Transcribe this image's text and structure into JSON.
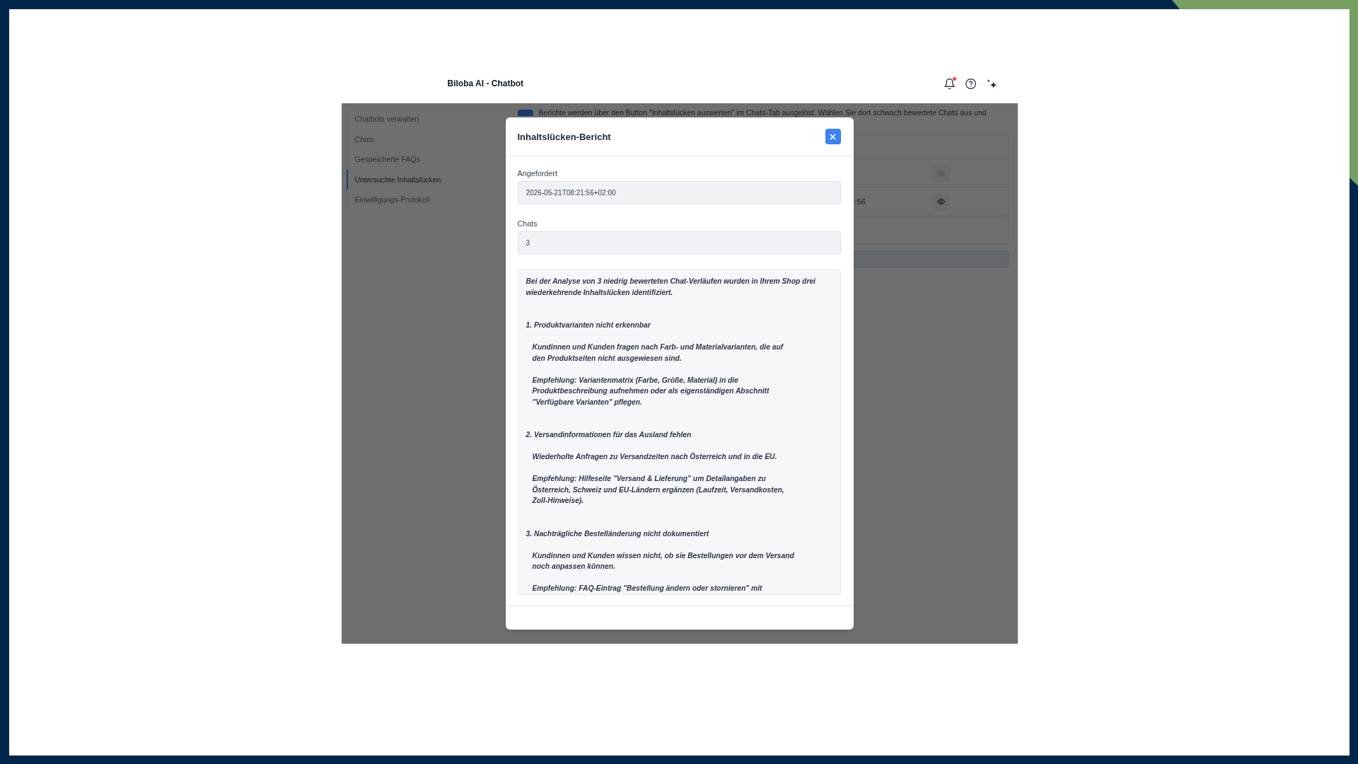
{
  "header": {
    "title": "Biloba AI - Chatbot",
    "unread_notifications": true
  },
  "sidebar": {
    "items": [
      {
        "label": "Chatbots verwalten",
        "selected": false
      },
      {
        "label": "Chats",
        "selected": false
      },
      {
        "label": "Gespeicherte FAQs",
        "selected": false
      },
      {
        "label": "Untersuchte Inhaltslücken",
        "selected": true
      },
      {
        "label": "Einwilligungs-Protokoll",
        "selected": false
      }
    ]
  },
  "content": {
    "notice": "Berichte werden über den Button \"Inhaltslücken auswerten\" im Chats-Tab ausgelöst. Wählen Sie dort schwach bewertete Chats aus und",
    "table": {
      "rows": [
        {
          "view_disabled": true
        },
        {
          "column_2": ":56",
          "view_disabled": false
        }
      ]
    }
  },
  "dialog": {
    "title": "Inhaltslücken-Bericht",
    "fields": [
      {
        "label": "Angefordert",
        "value": "2026-05-21T08:21:56+02:00"
      },
      {
        "label": "Chats",
        "value": "3"
      }
    ],
    "report": {
      "intro": "Bei der Analyse von 3 niedrig bewerteten Chat-Verläufen wurden in Ihrem Shop drei\nwiederkehrende Inhaltslücken identifiziert.",
      "sections": [
        {
          "heading": "1. Produktvarianten nicht erkennbar",
          "paragraphs": [
            "Kundinnen und Kunden fragen nach Farb- und Materialvarianten, die auf\nden Produktseiten nicht ausgewiesen sind.",
            "Empfehlung: Variantenmatrix (Farbe, Größe, Material) in die\nProduktbeschreibung aufnehmen oder als eigenständigen Abschnitt\n\"Verfügbare Varianten\" pflegen."
          ]
        },
        {
          "heading": "2. Versandinformationen für das Ausland fehlen",
          "paragraphs": [
            "Wiederholte Anfragen zu Versandzeiten nach Österreich und in die EU.",
            "Empfehlung: Hilfeseite \"Versand & Lieferung\" um Detailangaben zu\nÖsterreich, Schweiz und EU-Ländern ergänzen (Laufzeit, Versandkosten,\nZoll-Hinweise)."
          ]
        },
        {
          "heading": "3. Nachträgliche Bestelländerung nicht dokumentiert",
          "paragraphs": [
            "Kundinnen und Kunden wissen nicht, ob sie Bestellungen vor dem Versand\nnoch anpassen können.",
            "Empfehlung: FAQ-Eintrag \"Bestellung ändern oder stornieren\" mit"
          ]
        }
      ]
    }
  }
}
